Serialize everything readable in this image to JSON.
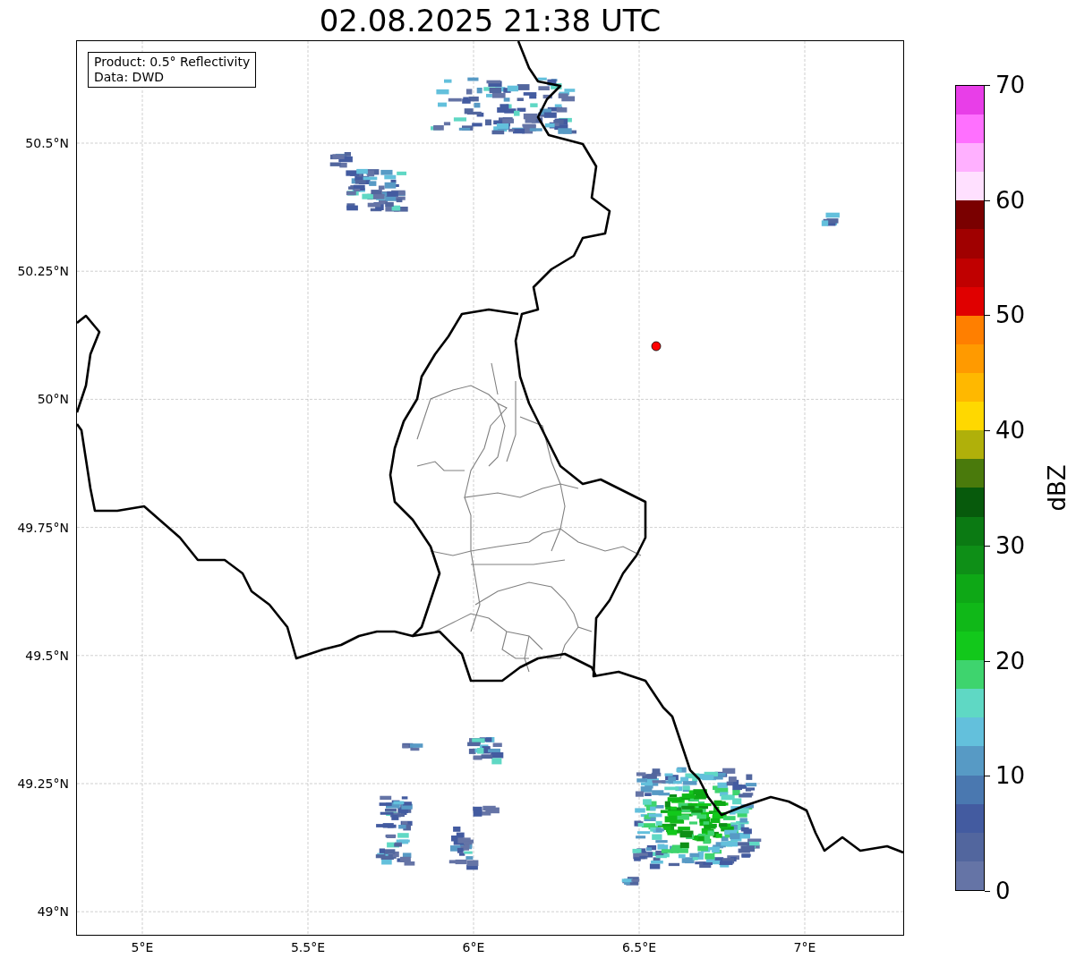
{
  "title": "02.08.2025 21:38 UTC",
  "legend": [
    "Product: 0.5° Reflectivity",
    "Data: DWD"
  ],
  "map": {
    "x_ticks": [
      "5°E",
      "5.5°E",
      "6°E",
      "6.5°E",
      "7°E"
    ],
    "y_ticks": [
      "50.5°N",
      "50.25°N",
      "50°N",
      "49.75°N",
      "49.5°N",
      "49.25°N",
      "49°N"
    ]
  },
  "colorbar": {
    "label": "dBZ",
    "ticks": [
      "70",
      "60",
      "50",
      "40",
      "30",
      "20",
      "10",
      "0"
    ],
    "bins": [
      {
        "color": "#6574a6"
      },
      {
        "color": "#52669e"
      },
      {
        "color": "#435ba0"
      },
      {
        "color": "#4a78b0"
      },
      {
        "color": "#579ac5"
      },
      {
        "color": "#63c0dc"
      },
      {
        "color": "#5fd8c4"
      },
      {
        "color": "#3ed46e"
      },
      {
        "color": "#12c81b"
      },
      {
        "color": "#10b818"
      },
      {
        "color": "#0ea816"
      },
      {
        "color": "#0e8f17"
      },
      {
        "color": "#0b7a13"
      },
      {
        "color": "#075a0c"
      },
      {
        "color": "#4a7a0c"
      },
      {
        "color": "#b0b00a"
      },
      {
        "color": "#ffd800"
      },
      {
        "color": "#ffb800"
      },
      {
        "color": "#ff9a00"
      },
      {
        "color": "#ff7f00"
      },
      {
        "color": "#e00000"
      },
      {
        "color": "#c00000"
      },
      {
        "color": "#a00000"
      },
      {
        "color": "#7a0000"
      },
      {
        "color": "#ffe0ff"
      },
      {
        "color": "#ffb0ff"
      },
      {
        "color": "#ff70ff"
      },
      {
        "color": "#e83ee8"
      }
    ]
  }
}
